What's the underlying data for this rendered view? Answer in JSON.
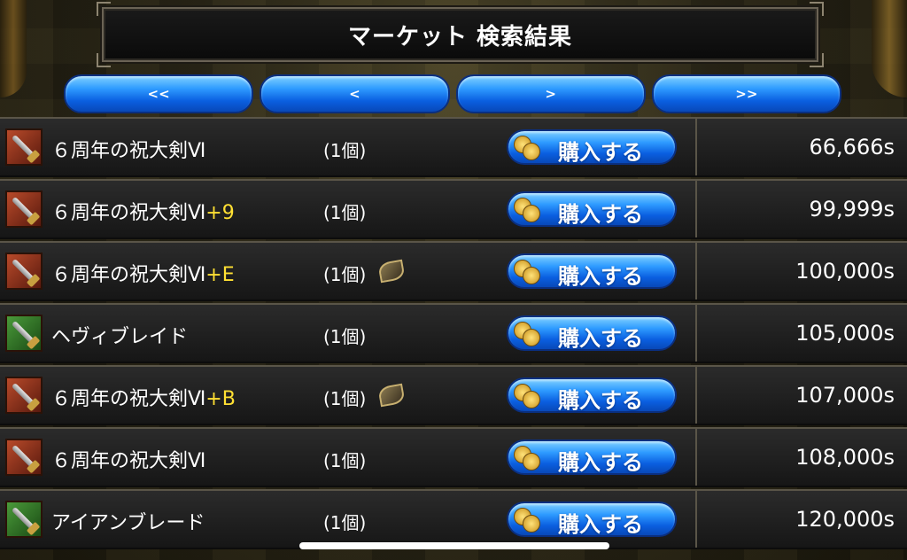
{
  "header": {
    "title": "マーケット 検索結果"
  },
  "nav": [
    {
      "label": "<<"
    },
    {
      "label": "<"
    },
    {
      "label": ">"
    },
    {
      "label": ">>"
    }
  ],
  "buy_label": "購入する",
  "rows": [
    {
      "name": "６周年の祝大剣Ⅵ",
      "plus": "",
      "qty": "(1個)",
      "seed": false,
      "price": "66,666s",
      "icon_color": "red"
    },
    {
      "name": "６周年の祝大剣Ⅵ",
      "plus": "+9",
      "qty": "(1個)",
      "seed": false,
      "price": "99,999s",
      "icon_color": "red"
    },
    {
      "name": "６周年の祝大剣Ⅵ",
      "plus": "+E",
      "qty": "(1個)",
      "seed": true,
      "price": "100,000s",
      "icon_color": "red"
    },
    {
      "name": "ヘヴィブレイド",
      "plus": "",
      "qty": "(1個)",
      "seed": false,
      "price": "105,000s",
      "icon_color": "green"
    },
    {
      "name": "６周年の祝大剣Ⅵ",
      "plus": "+B",
      "qty": "(1個)",
      "seed": true,
      "price": "107,000s",
      "icon_color": "red"
    },
    {
      "name": "６周年の祝大剣Ⅵ",
      "plus": "",
      "qty": "(1個)",
      "seed": false,
      "price": "108,000s",
      "icon_color": "red"
    },
    {
      "name": "アイアンブレード",
      "plus": "",
      "qty": "(1個)",
      "seed": false,
      "price": "120,000s",
      "icon_color": "green"
    }
  ]
}
